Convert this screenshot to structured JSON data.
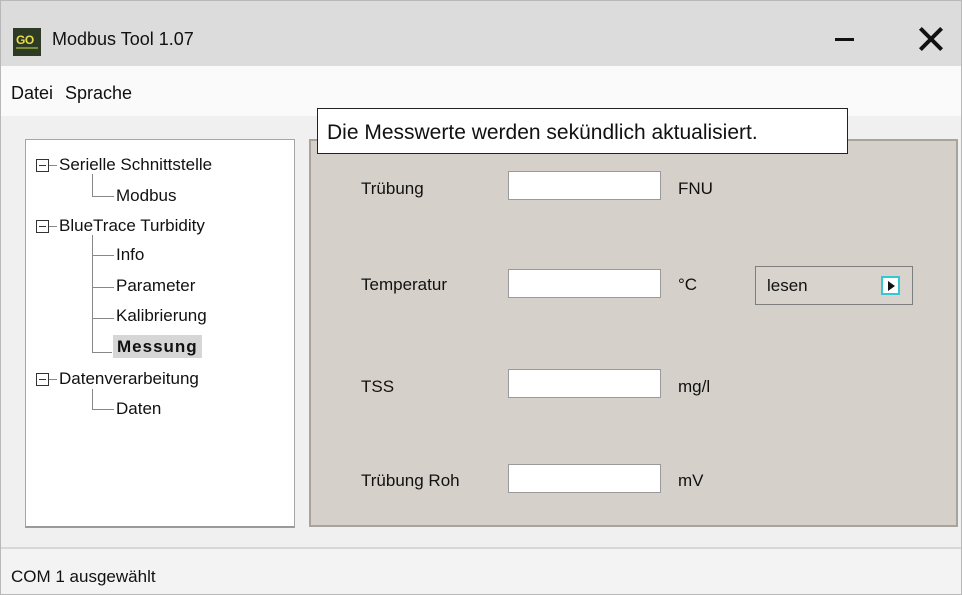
{
  "window": {
    "title": "Modbus Tool 1.07",
    "logo_text": "GO"
  },
  "menu": {
    "items": [
      "Datei",
      "Sprache"
    ]
  },
  "tree": {
    "groups": [
      {
        "label": "Serielle Schnittstelle",
        "children": [
          "Modbus"
        ]
      },
      {
        "label": "BlueTrace Turbidity",
        "children": [
          "Info",
          "Parameter",
          "Kalibrierung",
          "Messung"
        ]
      },
      {
        "label": "Datenverarbeitung",
        "children": [
          "Daten"
        ]
      }
    ],
    "selected": "Messung"
  },
  "tooltip": "Die Messwerte werden sekündlich aktualisiert.",
  "fields": [
    {
      "label": "Trübung",
      "value": "",
      "unit": "FNU"
    },
    {
      "label": "Temperatur",
      "value": "",
      "unit": "°C"
    },
    {
      "label": "TSS",
      "value": "",
      "unit": "mg/l"
    },
    {
      "label": "Trübung Roh",
      "value": "",
      "unit": "mV"
    }
  ],
  "temperature_action": {
    "selected": "lesen",
    "icon": "play-arrow-icon"
  },
  "status": "COM 1 ausgewählt",
  "colors": {
    "panel": "#d5d1ca",
    "tree_selected": "#d6d6d6",
    "arrow_border": "#35c8d0"
  }
}
